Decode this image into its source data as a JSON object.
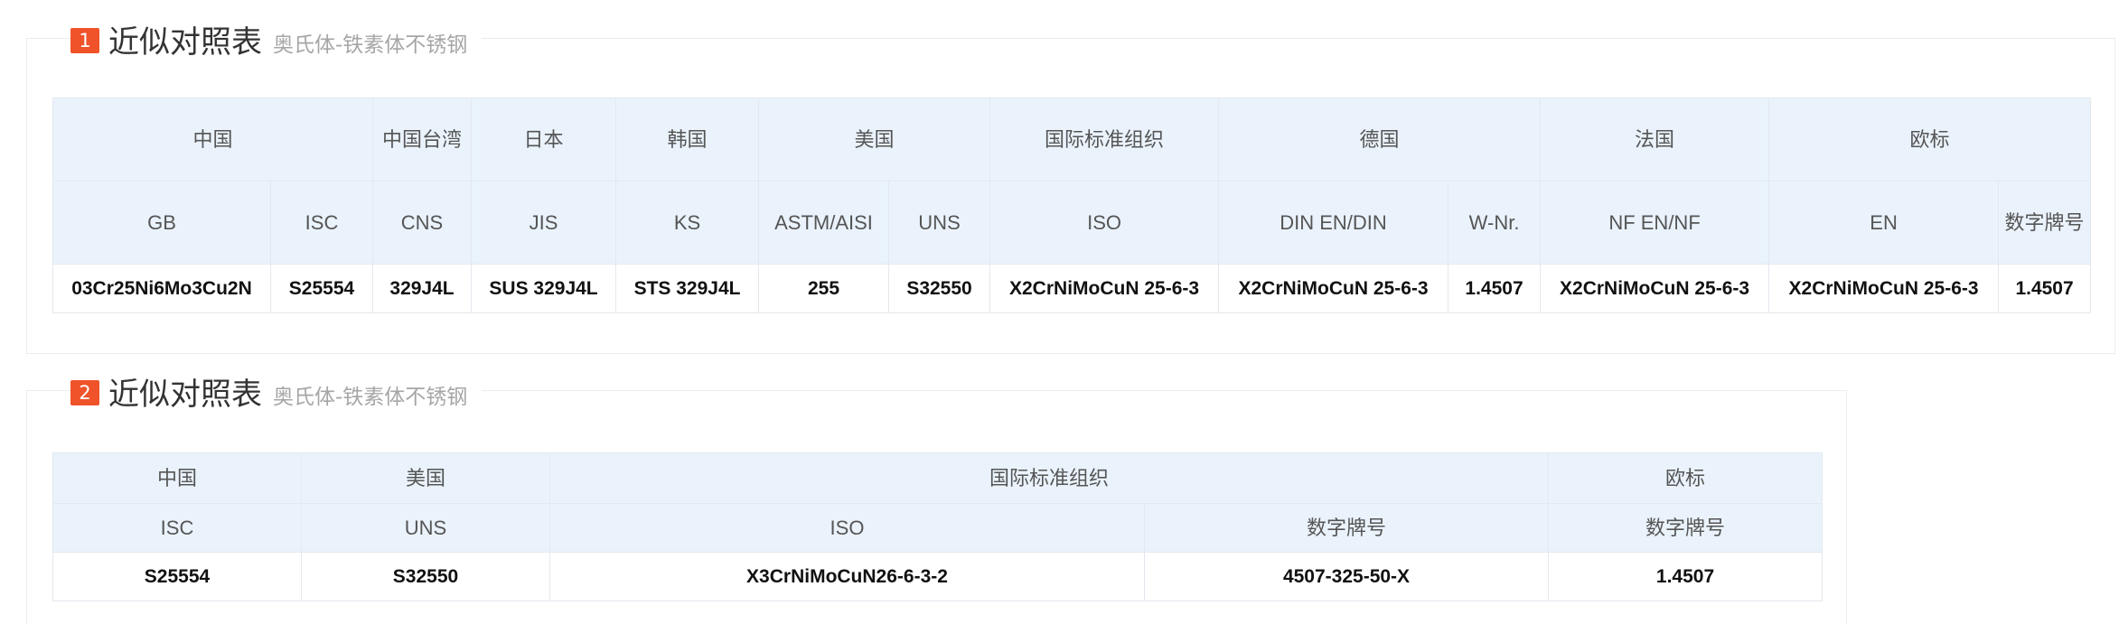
{
  "section1": {
    "number": "1",
    "title": "近似对照表",
    "subtitle": "奥氏体-铁素体不锈钢",
    "country_headers": [
      "中国",
      "中国台湾",
      "日本",
      "韩国",
      "美国",
      "国际标准组织",
      "德国",
      "法国",
      "欧标"
    ],
    "standard_headers": [
      "GB",
      "ISC",
      "CNS",
      "JIS",
      "KS",
      "ASTM/AISI",
      "UNS",
      "ISO",
      "DIN EN/DIN",
      "W-Nr.",
      "NF EN/NF",
      "EN",
      "数字牌号"
    ],
    "values": [
      "03Cr25Ni6Mo3Cu2N",
      "S25554",
      "329J4L",
      "SUS 329J4L",
      "STS 329J4L",
      "255",
      "S32550",
      "X2CrNiMoCuN 25-6-3",
      "X2CrNiMoCuN 25-6-3",
      "1.4507",
      "X2CrNiMoCuN 25-6-3",
      "X2CrNiMoCuN 25-6-3",
      "1.4507"
    ]
  },
  "section2": {
    "number": "2",
    "title": "近似对照表",
    "subtitle": "奥氏体-铁素体不锈钢",
    "country_headers": [
      "中国",
      "美国",
      "国际标准组织",
      "欧标"
    ],
    "standard_headers": [
      "ISC",
      "UNS",
      "ISO",
      "数字牌号",
      "数字牌号"
    ],
    "values": [
      "S25554",
      "S32550",
      "X3CrNiMoCuN26-6-3-2",
      "4507-325-50-X",
      "1.4507"
    ]
  },
  "colors": {
    "accent": "#f0532a",
    "header_bg": "#eaf3fc",
    "border": "#e3e8ee"
  }
}
